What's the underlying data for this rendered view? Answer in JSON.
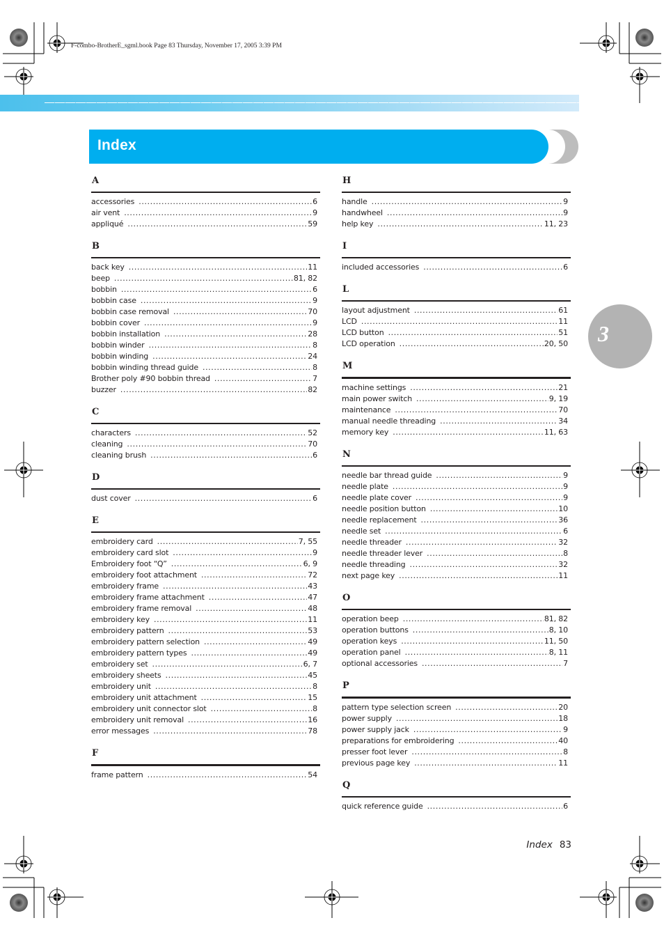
{
  "print_header": "F-combo-BrotherE_sgml.book  Page 83  Thursday, November 17, 2005  3:39 PM",
  "title": "Index",
  "chapter_number": "3",
  "colors": {
    "title_bar": "#00aeef",
    "chapter_tab": "#b3b3b3",
    "band_start": "#4cc0ec",
    "band_end": "#d2eafa"
  },
  "left_column": [
    {
      "letter": "A",
      "entries": [
        {
          "term": "accessories",
          "pages": "6"
        },
        {
          "term": "air vent",
          "pages": "9"
        },
        {
          "term": "appliqué",
          "pages": "59"
        }
      ]
    },
    {
      "letter": "B",
      "entries": [
        {
          "term": "back key",
          "pages": "11"
        },
        {
          "term": "beep",
          "pages": "81, 82"
        },
        {
          "term": "bobbin",
          "pages": "6"
        },
        {
          "term": "bobbin case",
          "pages": "9"
        },
        {
          "term": "bobbin case removal",
          "pages": "70"
        },
        {
          "term": "bobbin cover",
          "pages": "9"
        },
        {
          "term": "bobbin installation",
          "pages": "28"
        },
        {
          "term": "bobbin winder",
          "pages": "8"
        },
        {
          "term": "bobbin winding",
          "pages": "24"
        },
        {
          "term": "bobbin winding thread guide",
          "pages": "8"
        },
        {
          "term": "Brother poly #90 bobbin thread",
          "pages": "7"
        },
        {
          "term": "buzzer",
          "pages": "82"
        }
      ]
    },
    {
      "letter": "C",
      "entries": [
        {
          "term": "characters",
          "pages": "52"
        },
        {
          "term": "cleaning",
          "pages": "70"
        },
        {
          "term": "cleaning brush",
          "pages": "6"
        }
      ]
    },
    {
      "letter": "D",
      "entries": [
        {
          "term": "dust cover",
          "pages": "6"
        }
      ]
    },
    {
      "letter": "E",
      "entries": [
        {
          "term": "embroidery card",
          "pages": "7, 55"
        },
        {
          "term": "embroidery card slot",
          "pages": "9"
        },
        {
          "term": "Embroidery foot “Q”",
          "pages": "6, 9"
        },
        {
          "term": "embroidery foot attachment",
          "pages": "72"
        },
        {
          "term": "embroidery frame",
          "pages": "43"
        },
        {
          "term": "embroidery frame attachment",
          "pages": "47"
        },
        {
          "term": "embroidery frame removal",
          "pages": "48"
        },
        {
          "term": "embroidery key",
          "pages": "11"
        },
        {
          "term": "embroidery pattern",
          "pages": "53"
        },
        {
          "term": "embroidery pattern selection",
          "pages": "49"
        },
        {
          "term": "embroidery pattern types",
          "pages": "49"
        },
        {
          "term": "embroidery set",
          "pages": "6, 7"
        },
        {
          "term": "embroidery sheets",
          "pages": "45"
        },
        {
          "term": "embroidery unit",
          "pages": "8"
        },
        {
          "term": "embroidery unit attachment",
          "pages": "15"
        },
        {
          "term": "embroidery unit connector slot",
          "pages": "8"
        },
        {
          "term": "embroidery unit removal",
          "pages": "16"
        },
        {
          "term": "error messages",
          "pages": "78"
        }
      ]
    },
    {
      "letter": "F",
      "entries": [
        {
          "term": "frame pattern",
          "pages": "54"
        }
      ]
    }
  ],
  "right_column": [
    {
      "letter": "H",
      "entries": [
        {
          "term": "handle",
          "pages": "9"
        },
        {
          "term": "handwheel",
          "pages": "9"
        },
        {
          "term": "help key",
          "pages": "11, 23"
        }
      ]
    },
    {
      "letter": "I",
      "entries": [
        {
          "term": "included accessories",
          "pages": "6"
        }
      ]
    },
    {
      "letter": "L",
      "entries": [
        {
          "term": "layout adjustment",
          "pages": "61"
        },
        {
          "term": "LCD",
          "pages": "11"
        },
        {
          "term": "LCD button",
          "pages": "51"
        },
        {
          "term": "LCD operation",
          "pages": "20, 50"
        }
      ]
    },
    {
      "letter": "M",
      "entries": [
        {
          "term": "machine settings",
          "pages": "21"
        },
        {
          "term": "main power switch",
          "pages": "9, 19"
        },
        {
          "term": "maintenance",
          "pages": "70"
        },
        {
          "term": "manual needle threading",
          "pages": "34"
        },
        {
          "term": "memory key",
          "pages": "11, 63"
        }
      ]
    },
    {
      "letter": "N",
      "entries": [
        {
          "term": "needle bar thread guide",
          "pages": "9"
        },
        {
          "term": "needle plate",
          "pages": "9"
        },
        {
          "term": "needle plate cover",
          "pages": "9"
        },
        {
          "term": "needle position button",
          "pages": "10"
        },
        {
          "term": "needle replacement",
          "pages": "36"
        },
        {
          "term": "needle set",
          "pages": "6"
        },
        {
          "term": "needle threader",
          "pages": "32"
        },
        {
          "term": "needle threader lever",
          "pages": "8"
        },
        {
          "term": "needle threading",
          "pages": "32"
        },
        {
          "term": "next page key",
          "pages": "11"
        }
      ]
    },
    {
      "letter": "O",
      "entries": [
        {
          "term": "operation beep",
          "pages": "81, 82"
        },
        {
          "term": "operation buttons",
          "pages": "8, 10"
        },
        {
          "term": "operation keys",
          "pages": "11, 50"
        },
        {
          "term": "operation panel",
          "pages": "8, 11"
        },
        {
          "term": "optional accessories",
          "pages": "7"
        }
      ]
    },
    {
      "letter": "P",
      "entries": [
        {
          "term": "pattern type selection screen",
          "pages": "20"
        },
        {
          "term": "power supply",
          "pages": "18"
        },
        {
          "term": "power supply jack",
          "pages": "9"
        },
        {
          "term": "preparations for embroidering",
          "pages": "40"
        },
        {
          "term": "presser foot lever",
          "pages": "8"
        },
        {
          "term": "previous page key",
          "pages": "11"
        }
      ]
    },
    {
      "letter": "Q",
      "entries": [
        {
          "term": "quick reference guide",
          "pages": "6"
        }
      ]
    }
  ],
  "footer": {
    "label": "Index",
    "page_number": "83"
  }
}
